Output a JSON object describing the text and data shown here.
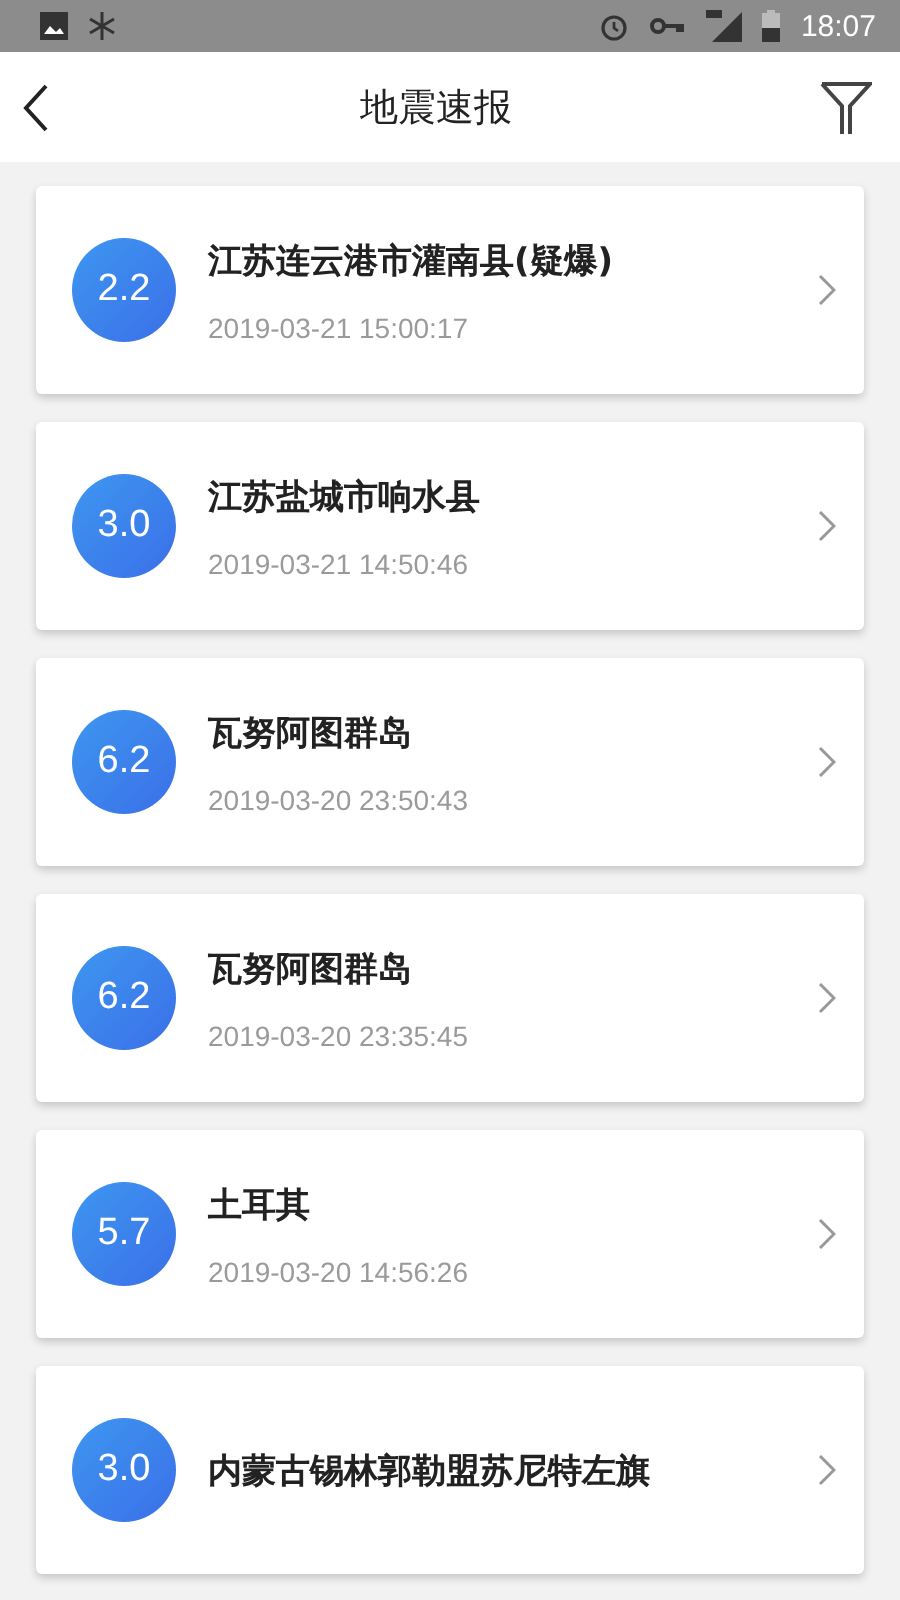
{
  "status_bar": {
    "time": "18:07"
  },
  "header": {
    "title": "地震速报"
  },
  "quakes": [
    {
      "magnitude": "2.2",
      "place": "江苏连云港市灌南县(疑爆)",
      "time": "2019-03-21 15:00:17"
    },
    {
      "magnitude": "3.0",
      "place": "江苏盐城市响水县",
      "time": "2019-03-21 14:50:46"
    },
    {
      "magnitude": "6.2",
      "place": "瓦努阿图群岛",
      "time": "2019-03-20 23:50:43"
    },
    {
      "magnitude": "6.2",
      "place": "瓦努阿图群岛",
      "time": "2019-03-20 23:35:45"
    },
    {
      "magnitude": "5.7",
      "place": "土耳其",
      "time": "2019-03-20 14:56:26"
    },
    {
      "magnitude": "3.0",
      "place": "内蒙古锡林郭勒盟苏尼特左旗"
    }
  ]
}
